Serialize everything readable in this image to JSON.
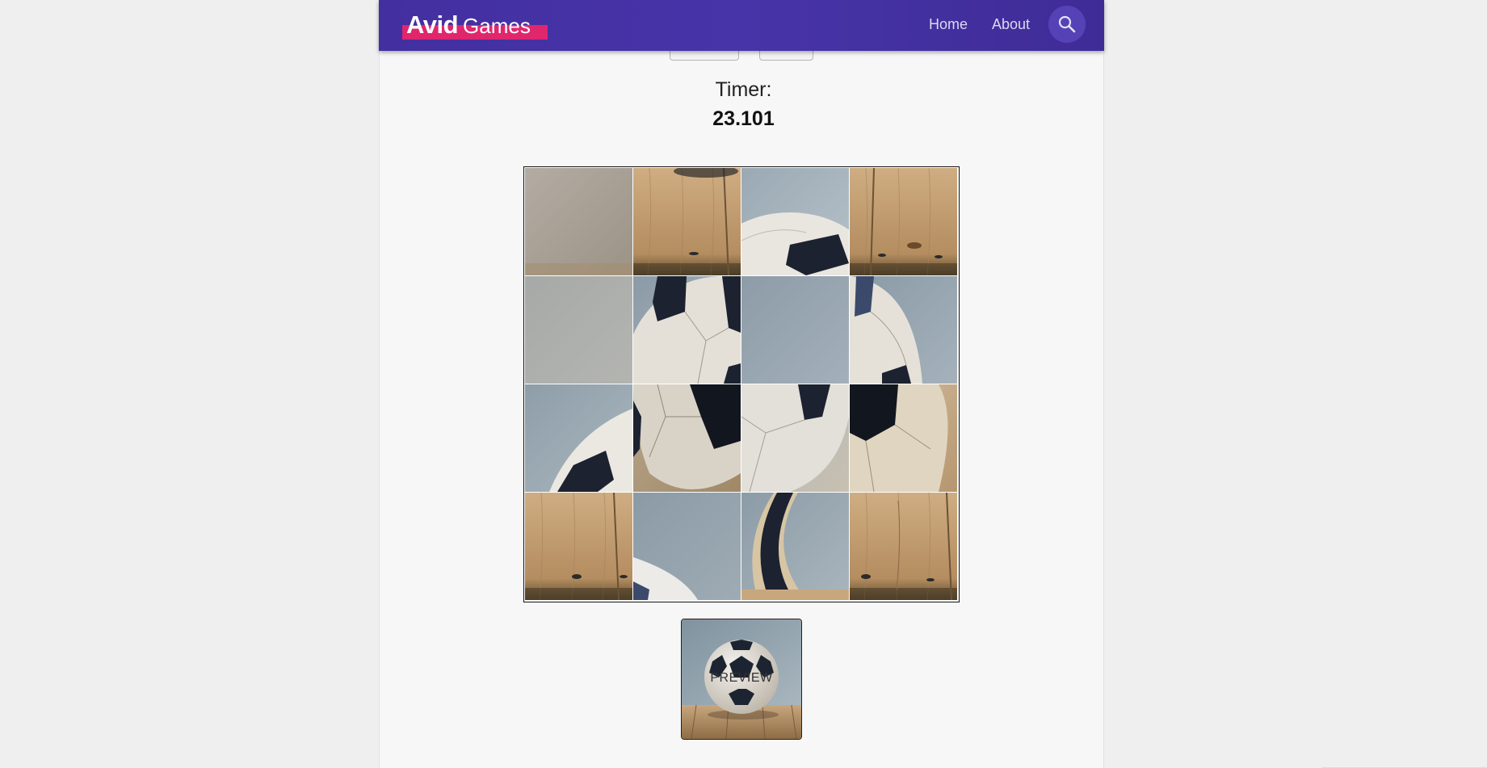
{
  "brand": {
    "name_bold": "Avid",
    "name_light": "Games",
    "highlight_color": "#e0266c"
  },
  "nav": {
    "links": [
      {
        "label": "Home"
      },
      {
        "label": "About"
      }
    ],
    "search_icon": "search-icon",
    "background_color": "#4431a2"
  },
  "game": {
    "timer_label": "Timer:",
    "timer_value": "23.101",
    "grid_size": 4,
    "tiles": [
      "wall-tan",
      "floor-plank-seam",
      "ball-top-cap",
      "floor-plank-knots",
      "wall-grey",
      "ball-upper-left",
      "wall-blue",
      "ball-upper-right",
      "ball-edge-wall",
      "ball-lower-left",
      "ball-lower-center",
      "ball-lower-right",
      "floor-plank-edge",
      "wall-ball-rim",
      "ball-side-wall",
      "floor-plank-grain"
    ],
    "preview_label": "PREVIEW"
  }
}
